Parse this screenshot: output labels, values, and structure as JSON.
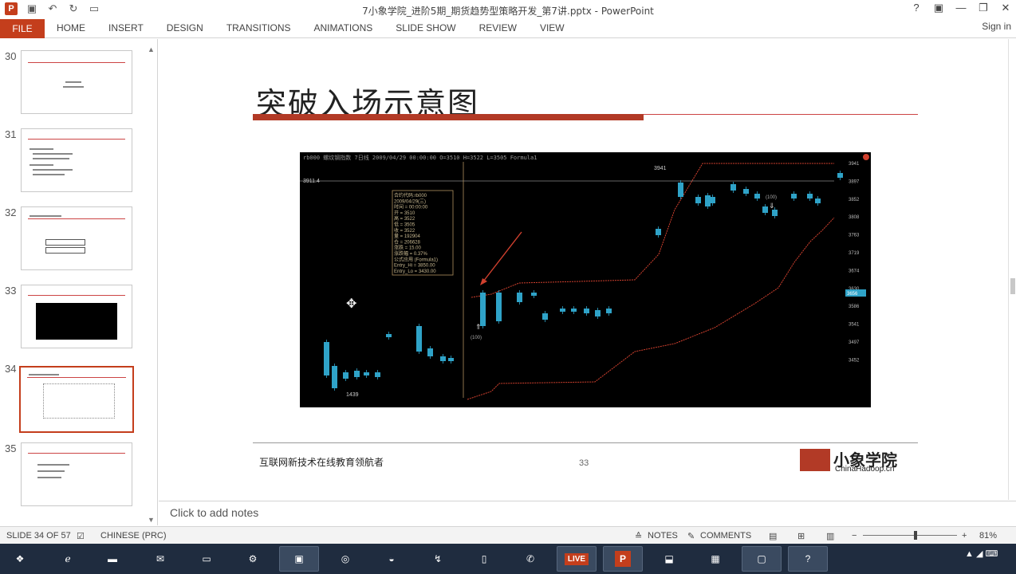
{
  "window": {
    "title": "7小象学院_进阶5期_期货趋势型策略开发_第7讲.pptx - PowerPoint",
    "app_icon_label": "P",
    "controls": [
      "?",
      "▣",
      "—",
      "❐",
      "✕"
    ]
  },
  "ribbon": {
    "file_label": "FILE",
    "tabs": [
      "HOME",
      "INSERT",
      "DESIGN",
      "TRANSITIONS",
      "ANIMATIONS",
      "SLIDE SHOW",
      "REVIEW",
      "VIEW"
    ],
    "signin": "Sign in"
  },
  "thumbnails": {
    "numbers": [
      "30",
      "31",
      "32",
      "33",
      "34",
      "35"
    ],
    "selected": "34"
  },
  "slide": {
    "title": "突破入场示意图",
    "footer_text": "互联网新技术在线教育领航者",
    "page_number": "33",
    "logo_cn": "小象学院",
    "logo_en": "ChinaHadoop.cn"
  },
  "chart_data": {
    "type": "candlestick",
    "header": "rb000  螺纹钢指数  7日线  2009/04/29 00:00:00  O=3510 H=3522 L=3505  Formula1",
    "y_ticks": [
      "3941",
      "3897",
      "3852",
      "3808",
      "3763",
      "3719",
      "3674",
      "3630",
      "3586",
      "3541",
      "3497",
      "3452"
    ],
    "current_price_label": "3656",
    "annotations": [
      "3941",
      "3911.4",
      "1439",
      "(100)",
      "(100)"
    ],
    "info_box": [
      "合约代码:rb000",
      "2009/04/29(三)",
      "时间 = 00:00:00",
      "开 = 3510",
      "高 = 3522",
      "低 = 3505",
      "收 = 3522",
      "量 = 192904",
      "仓 = 206628",
      "涨跌 = 15.00",
      "涨跌幅 = 0.37%",
      "公式应用 (Formula1)",
      "Entry_Hi = 3850.00",
      "Entry_Lo = 3430.00"
    ]
  },
  "notes": {
    "placeholder": "Click to add notes"
  },
  "status": {
    "slide_info": "SLIDE 34 OF 57",
    "language": "CHINESE (PRC)",
    "notes_label": "NOTES",
    "comments_label": "COMMENTS",
    "zoom": "81%"
  },
  "taskbar": {
    "live_label": "LIVE"
  },
  "colors": {
    "accent": "#c43e1c",
    "candle": "#2fa3c8",
    "channel": "#d0402e"
  }
}
